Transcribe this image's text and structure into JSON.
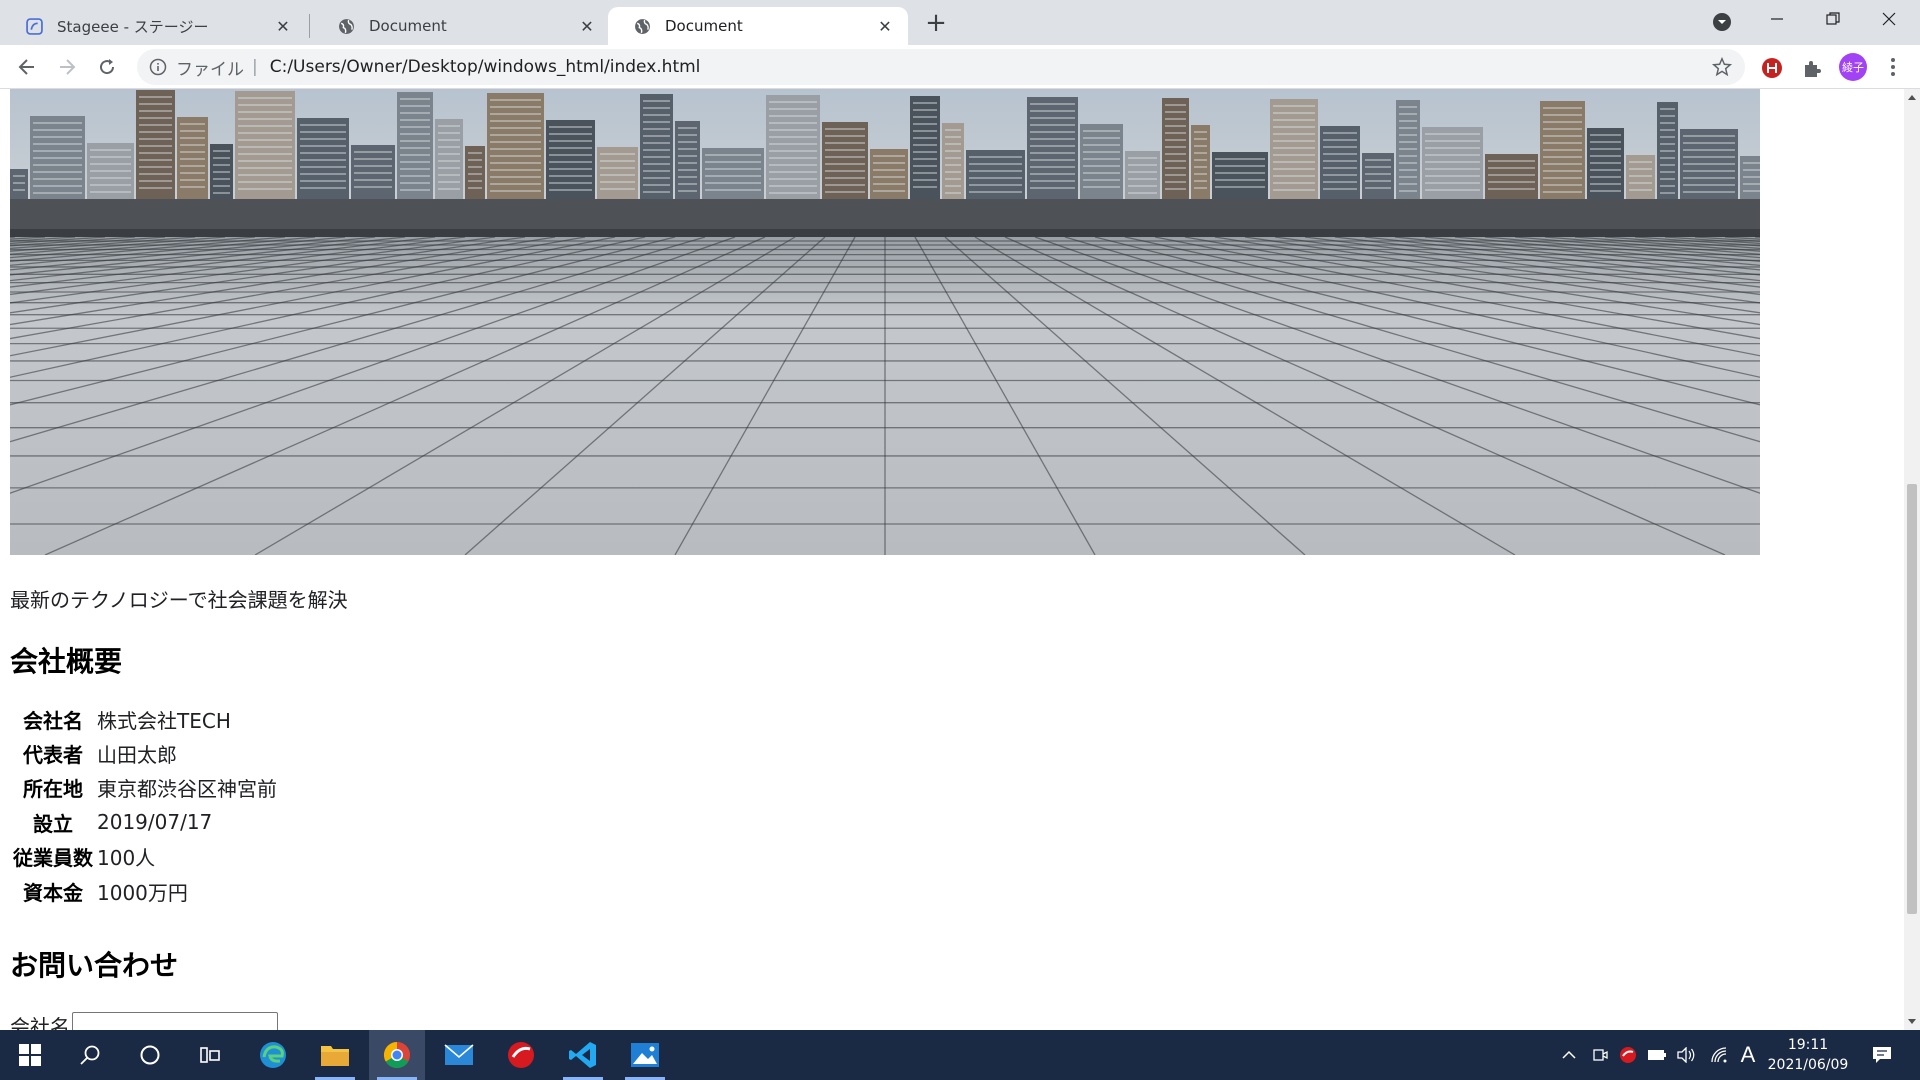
{
  "browser": {
    "tabs": [
      {
        "title": "Stageee - ステージー",
        "favicon": "stageee-icon",
        "active": false
      },
      {
        "title": "Document",
        "favicon": "globe-icon",
        "active": false
      },
      {
        "title": "Document",
        "favicon": "globe-icon",
        "active": true
      }
    ],
    "address": {
      "scheme_label": "ファイル",
      "separator": "|",
      "url": "C:/Users/Owner/Desktop/windows_html/index.html"
    },
    "profile_label": "綾子",
    "accent_color": "#a142f4"
  },
  "page": {
    "hero_image": "city-skyline-plaza-photo",
    "tagline": "最新のテクノロジーで社会課題を解決",
    "overview_heading": "会社概要",
    "company_info": [
      {
        "label": "会社名",
        "value": "株式会社TECH"
      },
      {
        "label": "代表者",
        "value": "山田太郎"
      },
      {
        "label": "所在地",
        "value": "東京都渋谷区神宮前"
      },
      {
        "label": "設立",
        "value": "2019/07/17"
      },
      {
        "label": "従業員数",
        "value": "100人"
      },
      {
        "label": "資本金",
        "value": "1000万円"
      }
    ],
    "contact_heading": "お問い合わせ",
    "contact_form": {
      "company_label": "会社名",
      "company_value": ""
    }
  },
  "taskbar": {
    "apps": [
      "windows-start-icon",
      "search-icon",
      "cortana-icon",
      "task-view-icon",
      "edge-icon",
      "file-explorer-icon",
      "chrome-icon",
      "mail-icon",
      "trend-micro-icon",
      "vscode-icon",
      "photos-icon"
    ],
    "ime_label": "A",
    "time": "19:11",
    "date": "2021/06/09"
  }
}
